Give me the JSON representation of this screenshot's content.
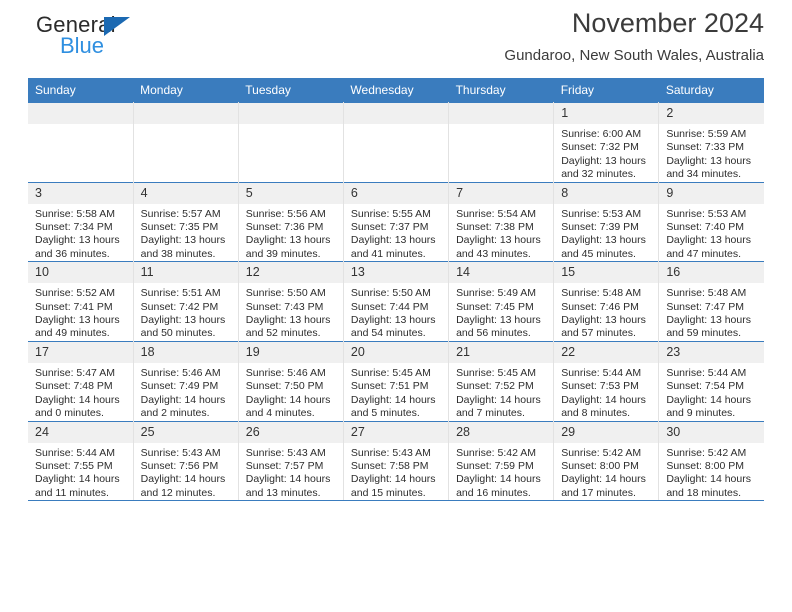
{
  "brand": {
    "name_top": "General",
    "name_bottom": "Blue",
    "triangle_color": "#1b69b2",
    "blue_text_color": "#2f8fe0"
  },
  "header": {
    "title": "November 2024",
    "subtitle": "Gundaroo, New South Wales, Australia",
    "header_bg_color": "#3a7cbe",
    "header_text_color": "#ffffff"
  },
  "weekdays": [
    "Sunday",
    "Monday",
    "Tuesday",
    "Wednesday",
    "Thursday",
    "Friday",
    "Saturday"
  ],
  "labels": {
    "sunrise_prefix": "Sunrise:",
    "sunset_prefix": "Sunset:",
    "daylight_prefix": "Daylight:"
  },
  "weeks": [
    [
      {
        "empty": true
      },
      {
        "empty": true
      },
      {
        "empty": true
      },
      {
        "empty": true
      },
      {
        "empty": true
      },
      {
        "day": "1",
        "sunrise": "Sunrise: 6:00 AM",
        "sunset": "Sunset: 7:32 PM",
        "daylight_1": "Daylight: 13 hours",
        "daylight_2": "and 32 minutes."
      },
      {
        "day": "2",
        "sunrise": "Sunrise: 5:59 AM",
        "sunset": "Sunset: 7:33 PM",
        "daylight_1": "Daylight: 13 hours",
        "daylight_2": "and 34 minutes."
      }
    ],
    [
      {
        "day": "3",
        "sunrise": "Sunrise: 5:58 AM",
        "sunset": "Sunset: 7:34 PM",
        "daylight_1": "Daylight: 13 hours",
        "daylight_2": "and 36 minutes."
      },
      {
        "day": "4",
        "sunrise": "Sunrise: 5:57 AM",
        "sunset": "Sunset: 7:35 PM",
        "daylight_1": "Daylight: 13 hours",
        "daylight_2": "and 38 minutes."
      },
      {
        "day": "5",
        "sunrise": "Sunrise: 5:56 AM",
        "sunset": "Sunset: 7:36 PM",
        "daylight_1": "Daylight: 13 hours",
        "daylight_2": "and 39 minutes."
      },
      {
        "day": "6",
        "sunrise": "Sunrise: 5:55 AM",
        "sunset": "Sunset: 7:37 PM",
        "daylight_1": "Daylight: 13 hours",
        "daylight_2": "and 41 minutes."
      },
      {
        "day": "7",
        "sunrise": "Sunrise: 5:54 AM",
        "sunset": "Sunset: 7:38 PM",
        "daylight_1": "Daylight: 13 hours",
        "daylight_2": "and 43 minutes."
      },
      {
        "day": "8",
        "sunrise": "Sunrise: 5:53 AM",
        "sunset": "Sunset: 7:39 PM",
        "daylight_1": "Daylight: 13 hours",
        "daylight_2": "and 45 minutes."
      },
      {
        "day": "9",
        "sunrise": "Sunrise: 5:53 AM",
        "sunset": "Sunset: 7:40 PM",
        "daylight_1": "Daylight: 13 hours",
        "daylight_2": "and 47 minutes."
      }
    ],
    [
      {
        "day": "10",
        "sunrise": "Sunrise: 5:52 AM",
        "sunset": "Sunset: 7:41 PM",
        "daylight_1": "Daylight: 13 hours",
        "daylight_2": "and 49 minutes."
      },
      {
        "day": "11",
        "sunrise": "Sunrise: 5:51 AM",
        "sunset": "Sunset: 7:42 PM",
        "daylight_1": "Daylight: 13 hours",
        "daylight_2": "and 50 minutes."
      },
      {
        "day": "12",
        "sunrise": "Sunrise: 5:50 AM",
        "sunset": "Sunset: 7:43 PM",
        "daylight_1": "Daylight: 13 hours",
        "daylight_2": "and 52 minutes."
      },
      {
        "day": "13",
        "sunrise": "Sunrise: 5:50 AM",
        "sunset": "Sunset: 7:44 PM",
        "daylight_1": "Daylight: 13 hours",
        "daylight_2": "and 54 minutes."
      },
      {
        "day": "14",
        "sunrise": "Sunrise: 5:49 AM",
        "sunset": "Sunset: 7:45 PM",
        "daylight_1": "Daylight: 13 hours",
        "daylight_2": "and 56 minutes."
      },
      {
        "day": "15",
        "sunrise": "Sunrise: 5:48 AM",
        "sunset": "Sunset: 7:46 PM",
        "daylight_1": "Daylight: 13 hours",
        "daylight_2": "and 57 minutes."
      },
      {
        "day": "16",
        "sunrise": "Sunrise: 5:48 AM",
        "sunset": "Sunset: 7:47 PM",
        "daylight_1": "Daylight: 13 hours",
        "daylight_2": "and 59 minutes."
      }
    ],
    [
      {
        "day": "17",
        "sunrise": "Sunrise: 5:47 AM",
        "sunset": "Sunset: 7:48 PM",
        "daylight_1": "Daylight: 14 hours",
        "daylight_2": "and 0 minutes."
      },
      {
        "day": "18",
        "sunrise": "Sunrise: 5:46 AM",
        "sunset": "Sunset: 7:49 PM",
        "daylight_1": "Daylight: 14 hours",
        "daylight_2": "and 2 minutes."
      },
      {
        "day": "19",
        "sunrise": "Sunrise: 5:46 AM",
        "sunset": "Sunset: 7:50 PM",
        "daylight_1": "Daylight: 14 hours",
        "daylight_2": "and 4 minutes."
      },
      {
        "day": "20",
        "sunrise": "Sunrise: 5:45 AM",
        "sunset": "Sunset: 7:51 PM",
        "daylight_1": "Daylight: 14 hours",
        "daylight_2": "and 5 minutes."
      },
      {
        "day": "21",
        "sunrise": "Sunrise: 5:45 AM",
        "sunset": "Sunset: 7:52 PM",
        "daylight_1": "Daylight: 14 hours",
        "daylight_2": "and 7 minutes."
      },
      {
        "day": "22",
        "sunrise": "Sunrise: 5:44 AM",
        "sunset": "Sunset: 7:53 PM",
        "daylight_1": "Daylight: 14 hours",
        "daylight_2": "and 8 minutes."
      },
      {
        "day": "23",
        "sunrise": "Sunrise: 5:44 AM",
        "sunset": "Sunset: 7:54 PM",
        "daylight_1": "Daylight: 14 hours",
        "daylight_2": "and 9 minutes."
      }
    ],
    [
      {
        "day": "24",
        "sunrise": "Sunrise: 5:44 AM",
        "sunset": "Sunset: 7:55 PM",
        "daylight_1": "Daylight: 14 hours",
        "daylight_2": "and 11 minutes."
      },
      {
        "day": "25",
        "sunrise": "Sunrise: 5:43 AM",
        "sunset": "Sunset: 7:56 PM",
        "daylight_1": "Daylight: 14 hours",
        "daylight_2": "and 12 minutes."
      },
      {
        "day": "26",
        "sunrise": "Sunrise: 5:43 AM",
        "sunset": "Sunset: 7:57 PM",
        "daylight_1": "Daylight: 14 hours",
        "daylight_2": "and 13 minutes."
      },
      {
        "day": "27",
        "sunrise": "Sunrise: 5:43 AM",
        "sunset": "Sunset: 7:58 PM",
        "daylight_1": "Daylight: 14 hours",
        "daylight_2": "and 15 minutes."
      },
      {
        "day": "28",
        "sunrise": "Sunrise: 5:42 AM",
        "sunset": "Sunset: 7:59 PM",
        "daylight_1": "Daylight: 14 hours",
        "daylight_2": "and 16 minutes."
      },
      {
        "day": "29",
        "sunrise": "Sunrise: 5:42 AM",
        "sunset": "Sunset: 8:00 PM",
        "daylight_1": "Daylight: 14 hours",
        "daylight_2": "and 17 minutes."
      },
      {
        "day": "30",
        "sunrise": "Sunrise: 5:42 AM",
        "sunset": "Sunset: 8:00 PM",
        "daylight_1": "Daylight: 14 hours",
        "daylight_2": "and 18 minutes."
      }
    ]
  ]
}
